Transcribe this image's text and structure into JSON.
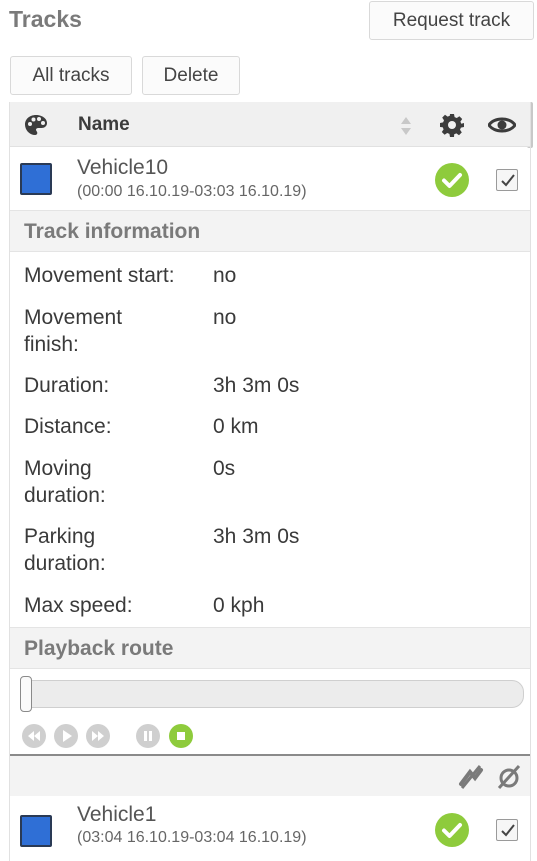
{
  "header": {
    "title": "Tracks",
    "request_track_label": "Request track"
  },
  "toolbar": {
    "all_tracks_label": "All tracks",
    "delete_label": "Delete"
  },
  "table": {
    "name_header": "Name"
  },
  "tracks": [
    {
      "name": "Vehicle10",
      "period": "(00:00 16.10.19-03:03 16.10.19)",
      "color": "#2f6fd6",
      "status": "ok",
      "visible": true
    },
    {
      "name": "Vehicle1",
      "period": "(03:04 16.10.19-03:04 16.10.19)",
      "color": "#2f6fd6",
      "status": "ok",
      "visible": true
    }
  ],
  "track_information": {
    "title": "Track information",
    "rows": [
      {
        "label": "Movement start:",
        "value": "no"
      },
      {
        "label": "Movement finish:",
        "value": "no"
      },
      {
        "label": "Duration:",
        "value": "3h 3m 0s"
      },
      {
        "label": "Distance:",
        "value": "0 km"
      },
      {
        "label": "Moving duration:",
        "value": "0s"
      },
      {
        "label": "Parking duration:",
        "value": "3h 3m 0s"
      },
      {
        "label": "Max speed:",
        "value": "0 kph"
      }
    ]
  },
  "playback": {
    "title": "Playback route",
    "progress": 0.0
  },
  "colors": {
    "accent_green": "#8ecb3c",
    "track_blue": "#2f6fd6"
  }
}
